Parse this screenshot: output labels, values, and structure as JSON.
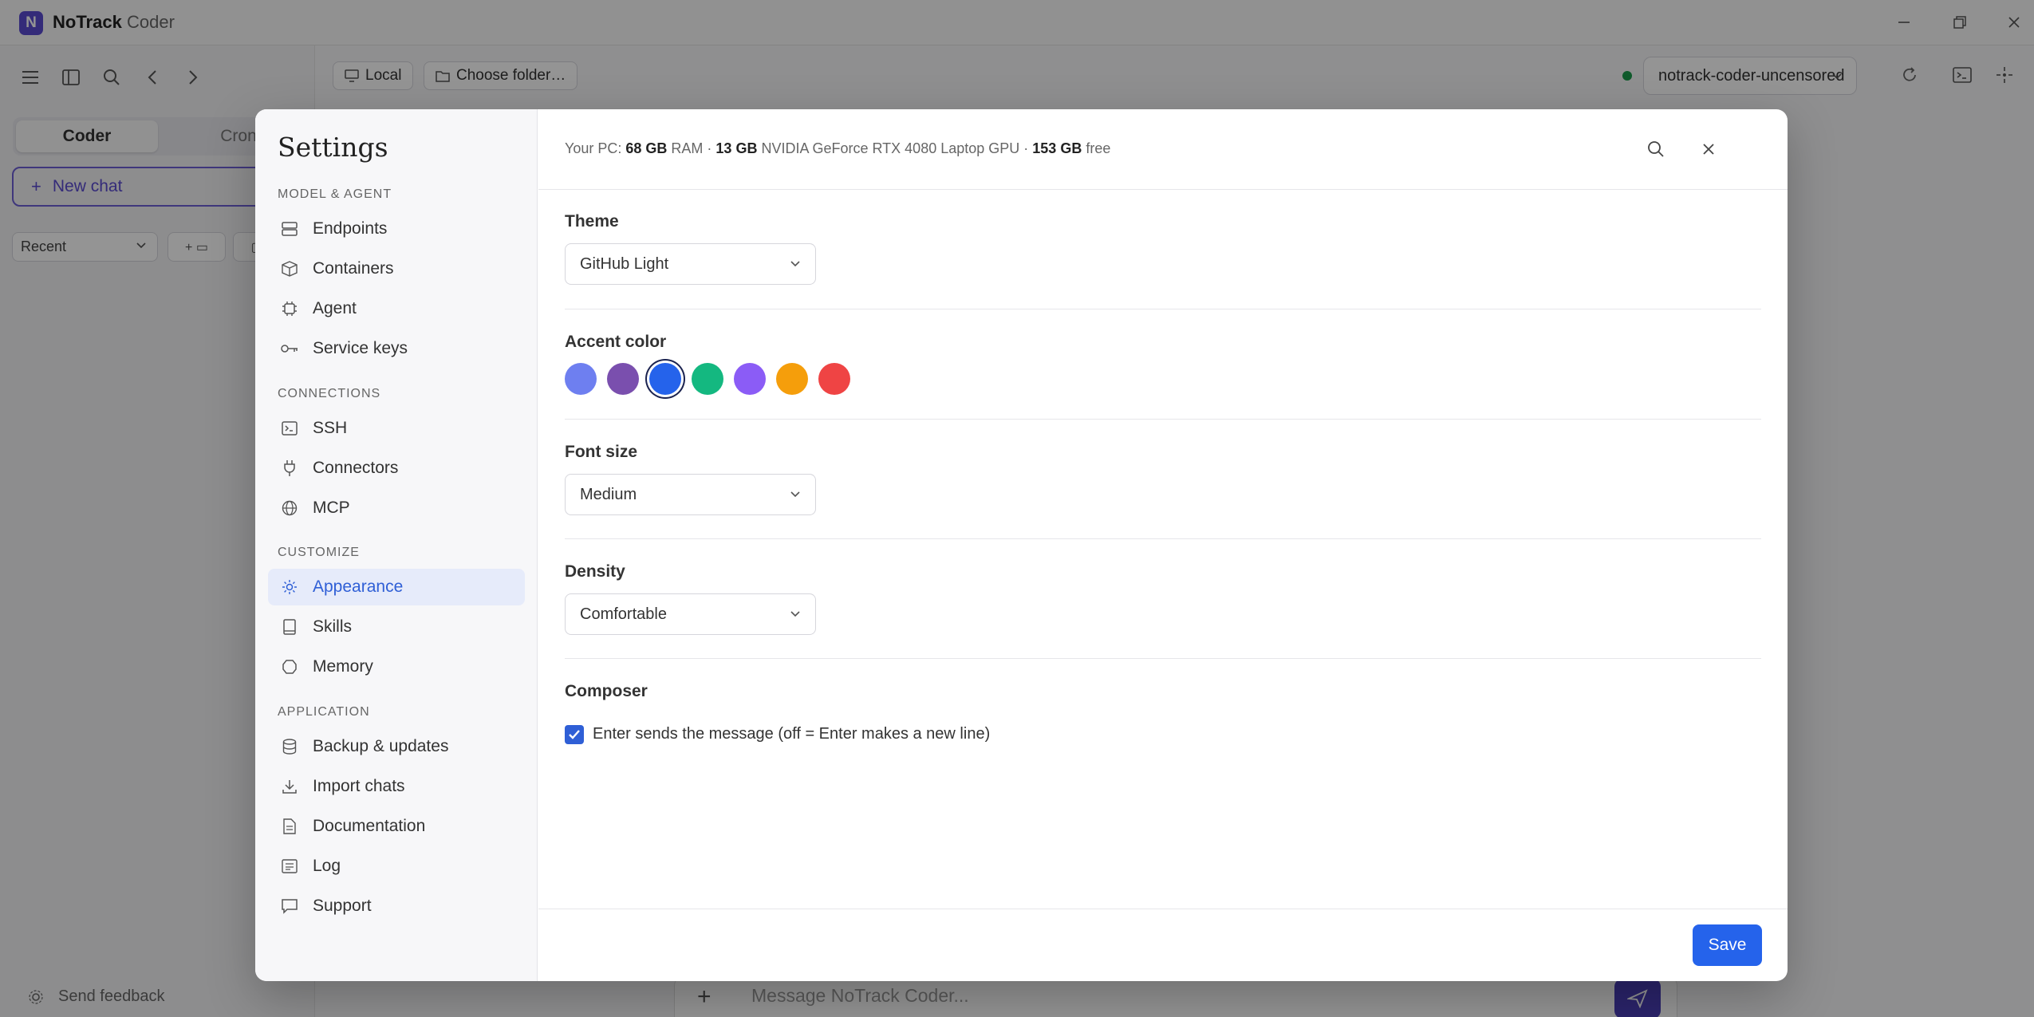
{
  "app": {
    "logo_letter": "N",
    "name": "NoTrack",
    "subtitle": "Coder"
  },
  "sidebar": {
    "tabs": [
      {
        "label": "Coder",
        "active": true
      },
      {
        "label": "Cron",
        "active": false
      }
    ],
    "new_chat": "New chat",
    "recent": "Recent",
    "feedback": "Send feedback"
  },
  "toolbar": {
    "local": "Local",
    "folder": "Choose folder…",
    "model": "notrack-coder-uncensored",
    "model_status_color": "#1a9c4a"
  },
  "composer": {
    "placeholder": "Message NoTrack Coder..."
  },
  "settings": {
    "title": "Settings",
    "sections": [
      {
        "label": "MODEL & AGENT",
        "items": [
          {
            "label": "Endpoints",
            "icon": "server-icon"
          },
          {
            "label": "Containers",
            "icon": "box-icon"
          },
          {
            "label": "Agent",
            "icon": "chip-icon"
          },
          {
            "label": "Service keys",
            "icon": "key-icon"
          }
        ]
      },
      {
        "label": "CONNECTIONS",
        "items": [
          {
            "label": "SSH",
            "icon": "terminal-icon"
          },
          {
            "label": "Connectors",
            "icon": "plug-icon"
          },
          {
            "label": "MCP",
            "icon": "globe-icon"
          }
        ]
      },
      {
        "label": "CUSTOMIZE",
        "items": [
          {
            "label": "Appearance",
            "icon": "sun-icon",
            "active": true
          },
          {
            "label": "Skills",
            "icon": "book-icon"
          },
          {
            "label": "Memory",
            "icon": "brain-icon"
          }
        ]
      },
      {
        "label": "APPLICATION",
        "items": [
          {
            "label": "Backup & updates",
            "icon": "database-icon"
          },
          {
            "label": "Import chats",
            "icon": "download-icon"
          },
          {
            "label": "Documentation",
            "icon": "document-icon"
          },
          {
            "label": "Log",
            "icon": "list-icon"
          },
          {
            "label": "Support",
            "icon": "chat-bubble-icon"
          }
        ]
      }
    ],
    "pc_info": {
      "prefix": "Your PC: ",
      "ram": "68 GB",
      "ram_unit": " RAM · ",
      "vram": "13 GB",
      "gpu": " NVIDIA GeForce RTX 4080 Laptop GPU · ",
      "disk": "153 GB",
      "disk_unit": " free"
    },
    "appearance": {
      "theme_label": "Theme",
      "theme_value": "GitHub Light",
      "accent_label": "Accent color",
      "accent_colors": [
        "#6e7ff0",
        "#7a4fae",
        "#2563eb",
        "#14b880",
        "#8b5cf6",
        "#f59e0b",
        "#ef4444"
      ],
      "accent_selected_index": 2,
      "font_size_label": "Font size",
      "font_size_value": "Medium",
      "density_label": "Density",
      "density_value": "Comfortable",
      "composer_label": "Composer",
      "enter_sends_label": "Enter sends the message (off = Enter makes a new line)",
      "enter_sends_checked": true
    },
    "save_label": "Save"
  }
}
